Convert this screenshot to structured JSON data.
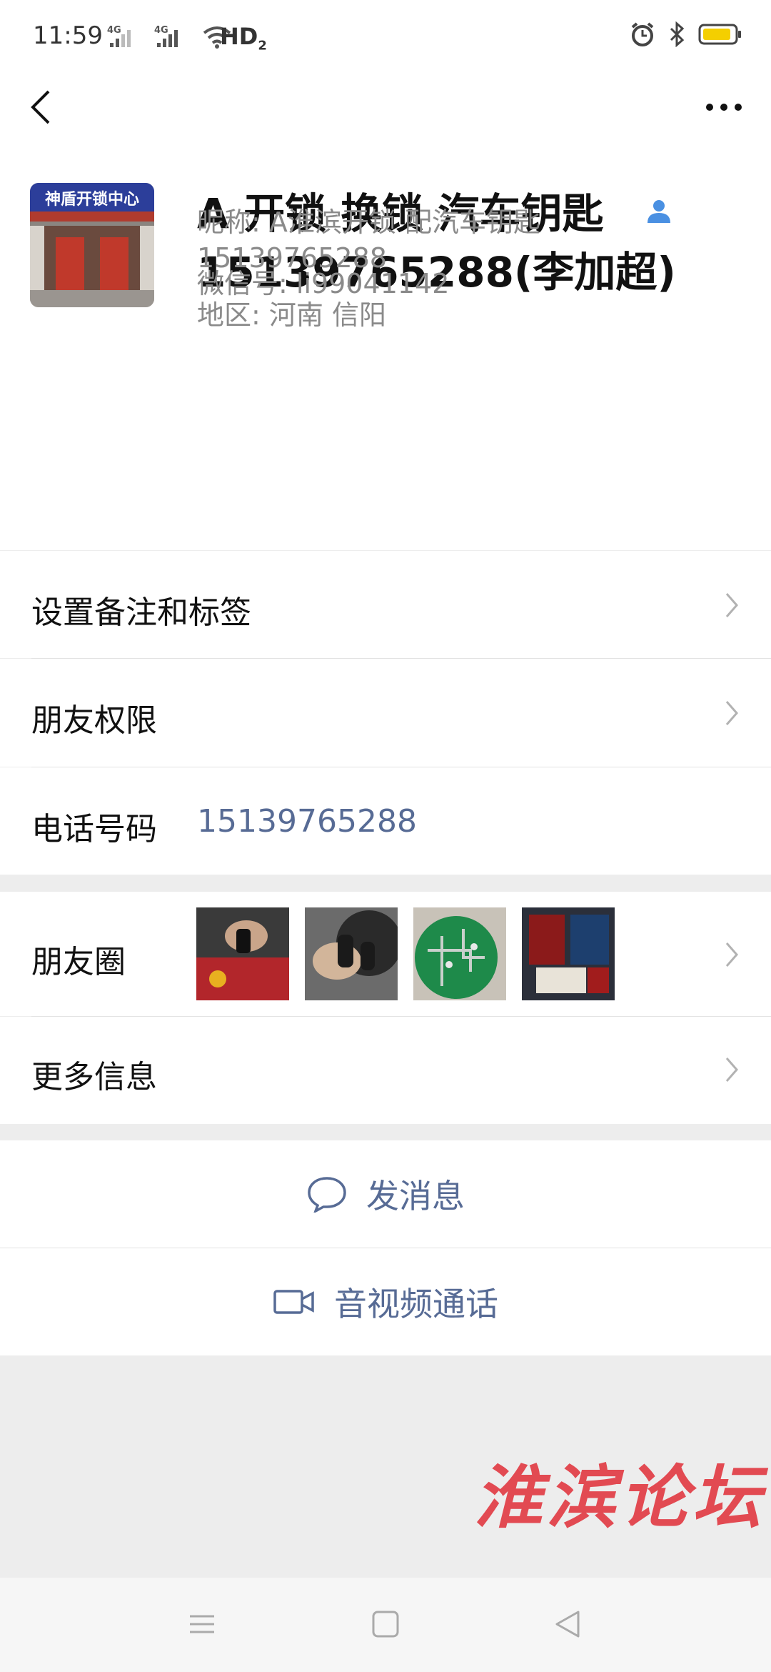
{
  "status_bar": {
    "time": "11:59",
    "network1": "4G",
    "network2": "4G",
    "hd": "HD",
    "hd_sub": "2",
    "battery_color": "#f4cf00"
  },
  "header": {
    "back_icon": "chevron-left-icon",
    "more_icon": "more-horizontal-icon"
  },
  "profile": {
    "display_name_line1": "A 开锁 换锁 汽车钥匙",
    "display_name_line2": "15139765288(李加超)",
    "nickname_line1": "昵称: A淮滨开锁 配汽车钥匙",
    "nickname_line2": "15139765288",
    "wechat_id": "微信号: li99041142",
    "region": "地区: 河南  信阳",
    "avatar_sign_text": "神盾开锁中心",
    "gender_icon": "male-user-icon",
    "gender_color": "#4a90e2"
  },
  "rows": {
    "remark": "设置备注和标签",
    "permissions": "朋友权限",
    "phone_label": "电话号码",
    "phone_value": "15139765288",
    "moments": "朋友圈",
    "more_info": "更多信息"
  },
  "actions": {
    "message": "发消息",
    "video_call": "音视频通话",
    "accent_color": "#576b95"
  },
  "watermark": "淮滨论坛",
  "nav": {
    "menu_icon": "menu-icon",
    "home_icon": "square-home-icon",
    "back_icon": "triangle-back-icon"
  }
}
